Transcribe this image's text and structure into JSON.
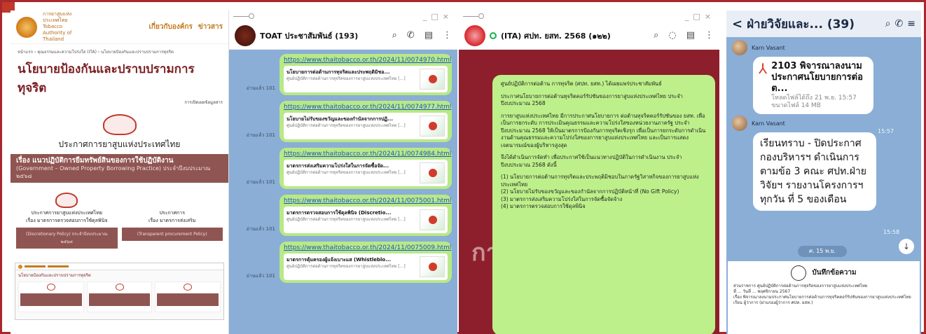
{
  "website": {
    "logo_text": "การยาสูบแห่งประเทศไทย Tobacco Authority of Thailand",
    "nav": [
      "เกี่ยวกับองค์กร",
      "ข่าวสาร"
    ],
    "breadcrumb": "หน้าแรก › คุณธรรมและความโปร่งใส (ITA) › นโยบายป้องกันและปราบปรามการทุจริต",
    "page_title": "นโยบายป้องกันและปราบปรามการทุจริต",
    "disclosure": "การเปิดเผยข้อมูลสาร",
    "doc_title": "ประกาศการยาสูบแห่งประเทศไทย",
    "doc_line1": "เรื่อง แนวปฏิบัติการยืมทรัพย์สินของการใช้ปฏิบัติงาน",
    "doc_line2": "(Government – Owned Property Borrowing Practice) ประจำปีงบประมาณ ๒๕๖๘",
    "col1_title": "ประกาศการยาสูบแห่งประเทศไทย",
    "col1_sub": "เรื่อง มาตรการตรวจสอบการใช้ดุลพินิจ",
    "col1_en": "(Discretionary Policy) ประจำปีงบประมาณ ๒๕๖๘",
    "col2_title": "ประกาศการ",
    "col2_sub": "เรื่อง มาตรการส่งเสริม",
    "col2_en": "(Transparent procurement Policy)",
    "thumb_title": "นโยบายป้องกันและปราบปรามการทุจริต"
  },
  "toat_chat": {
    "title": "TOAT ประชาสัมพันธ์ (193)",
    "read_label": "อ่านแล้ว 101",
    "messages": [
      {
        "url": "https://www.thaitobacco.or.th/2024/11/0074970.html",
        "title": "นโยบายการต่อต้านการทุจริตและประพฤติมิชอ...",
        "desc": "ศูนย์ปฏิบัติการต่อต้านการทุจริตของการยาสูบแห่งประเทศไทย [...]"
      },
      {
        "url": "https://www.thaitobacco.or.th/2024/11/0074977.html",
        "title": "นโยบายไม่รับของขวัญและของกำนัลจากการปฏิ...",
        "desc": "ศูนย์ปฏิบัติการต่อต้านการทุจริตของการยาสูบแห่งประเทศไทย [...]"
      },
      {
        "url": "https://www.thaitobacco.or.th/2024/11/0074984.html",
        "title": "มาตรการส่งเสริมความโปร่งใสในการจัดซื้อจัด...",
        "desc": "ศูนย์ปฏิบัติการต่อต้านการทุจริตของการยาสูบแห่งประเทศไทย [...]"
      },
      {
        "url": "https://www.thaitobacco.or.th/2024/11/0075001.html",
        "title": "มาตรการตรวจสอบการใช้ดุลพินิจ (Discretio...",
        "desc": "ศูนย์ปฏิบัติการต่อต้านการทุจริตของการยาสูบแห่งประเทศไทย [...]"
      },
      {
        "url": "https://www.thaitobacco.or.th/2024/11/0075009.html",
        "title": "มาตรการคุ้มครองผู้แจ้งเบาะแส (Whistleblo...",
        "desc": "ศูนย์ปฏิบัติการต่อต้านการทุจริตของการยาสูบแห่งประเทศไทย [...]"
      }
    ]
  },
  "ita_chat": {
    "title": "(ITA) ศปท. ยสท. 2568 (๑๒๒)",
    "bg_letters": "กา",
    "paragraphs": [
      "ศูนย์ปฏิบัติการต่อต้าน การทุจริต (ศปท. ยสท.) ได้เผยแพร่ประชาสัมพันธ์",
      "ประกาศนโยบายการต่อต้านทุจริตคอร์รัปชันของการยาสูบแห่งประเทศไทย ประจำปีงบประมาณ 2568",
      "การยาสูบแห่งประเทศไทย มีการประกาศนโยบายการ ต่อต้านทุจริตคอร์รัปชันของ ยสท. เพื่อเป็นการยกระดับ การประเมินคุณธรรมและความโปร่งใสของหน่วยงานภาครัฐ ประจำปีงบประมาณ 2568 ให้เป็นมาตรการป้องกันการทุจริตเชิงรุก เพื่อเป็นการยกระดับการดำเนินงานด้านคุณธรรมและความโปร่งใสของการยาสูบแห่งประเทศไทย และเป็นการแสดงเจตนารมณ์ของผู้บริหารสูงสุด",
      "จึงได้ดำเนินการจัดทำ เพื่อประกาศใช้เป็นแนวทางปฏิบัติในการดำเนินงาน ประจำปีงบประมาณ 2568 ดังนี้",
      "(1) นโยบายการต่อต้านการทุจริตและประพฤติมิชอบในภาครัฐวิสาหกิจของการยาสูบแห่งประเทศไทย",
      "(2) นโยบายไม่รับของขวัญและของกำนัลจากการปฏิบัติหน้าที่ (No Gift Policy)",
      "(3) มาตรการส่งเสริมความโปร่งใสในการจัดซื้อจัดจ้าง",
      "(4) มาตรการตรวจสอบการใช้ดุลพินิจ"
    ]
  },
  "line_chat": {
    "title": "ฝ่ายวิจัยและ... (39)",
    "sender": "Karn Vasant",
    "file_name": "2103 พิจารณาลงนามประกาศนโยบายการต่อต...",
    "file_expiry": "โหลดไฟล์ได้ถึง 21 พ.ย. 15:57",
    "file_size": "ขนาดไฟล์ 14 MB",
    "time1": "15:57",
    "message": "เรียนทราบ - ปิดประกาศ กองบริหารฯ ดำเนินการ ตามข้อ 3 คณะ ศปท.ฝ่ายวิจัยฯ รายงานโครงการฯ ทุกวัน ที่ 5 ของเดือน",
    "time2": "15:58",
    "date_pill": "ศ. 15 พ.ย.",
    "memo_title": "บันทึกข้อความ",
    "memo_line1": "ส่วนราชการ ศูนย์ปฏิบัติการต่อต้านการทุจริตของการยาสูบแห่งประเทศไทย",
    "memo_line2": "ที่ ... วันที่ ... พฤศจิกายน 2567",
    "memo_line3": "เรื่อง พิจารณาลงนามประกาศนโยบายการต่อต้านการทุจริตคอร์รัปชันของการยาสูบแห่งประเทศไทย",
    "memo_line4": "เรียน ผู้ว่าการ (ผ่านรองผู้ว่าการ ศปท. ยสท.)"
  }
}
